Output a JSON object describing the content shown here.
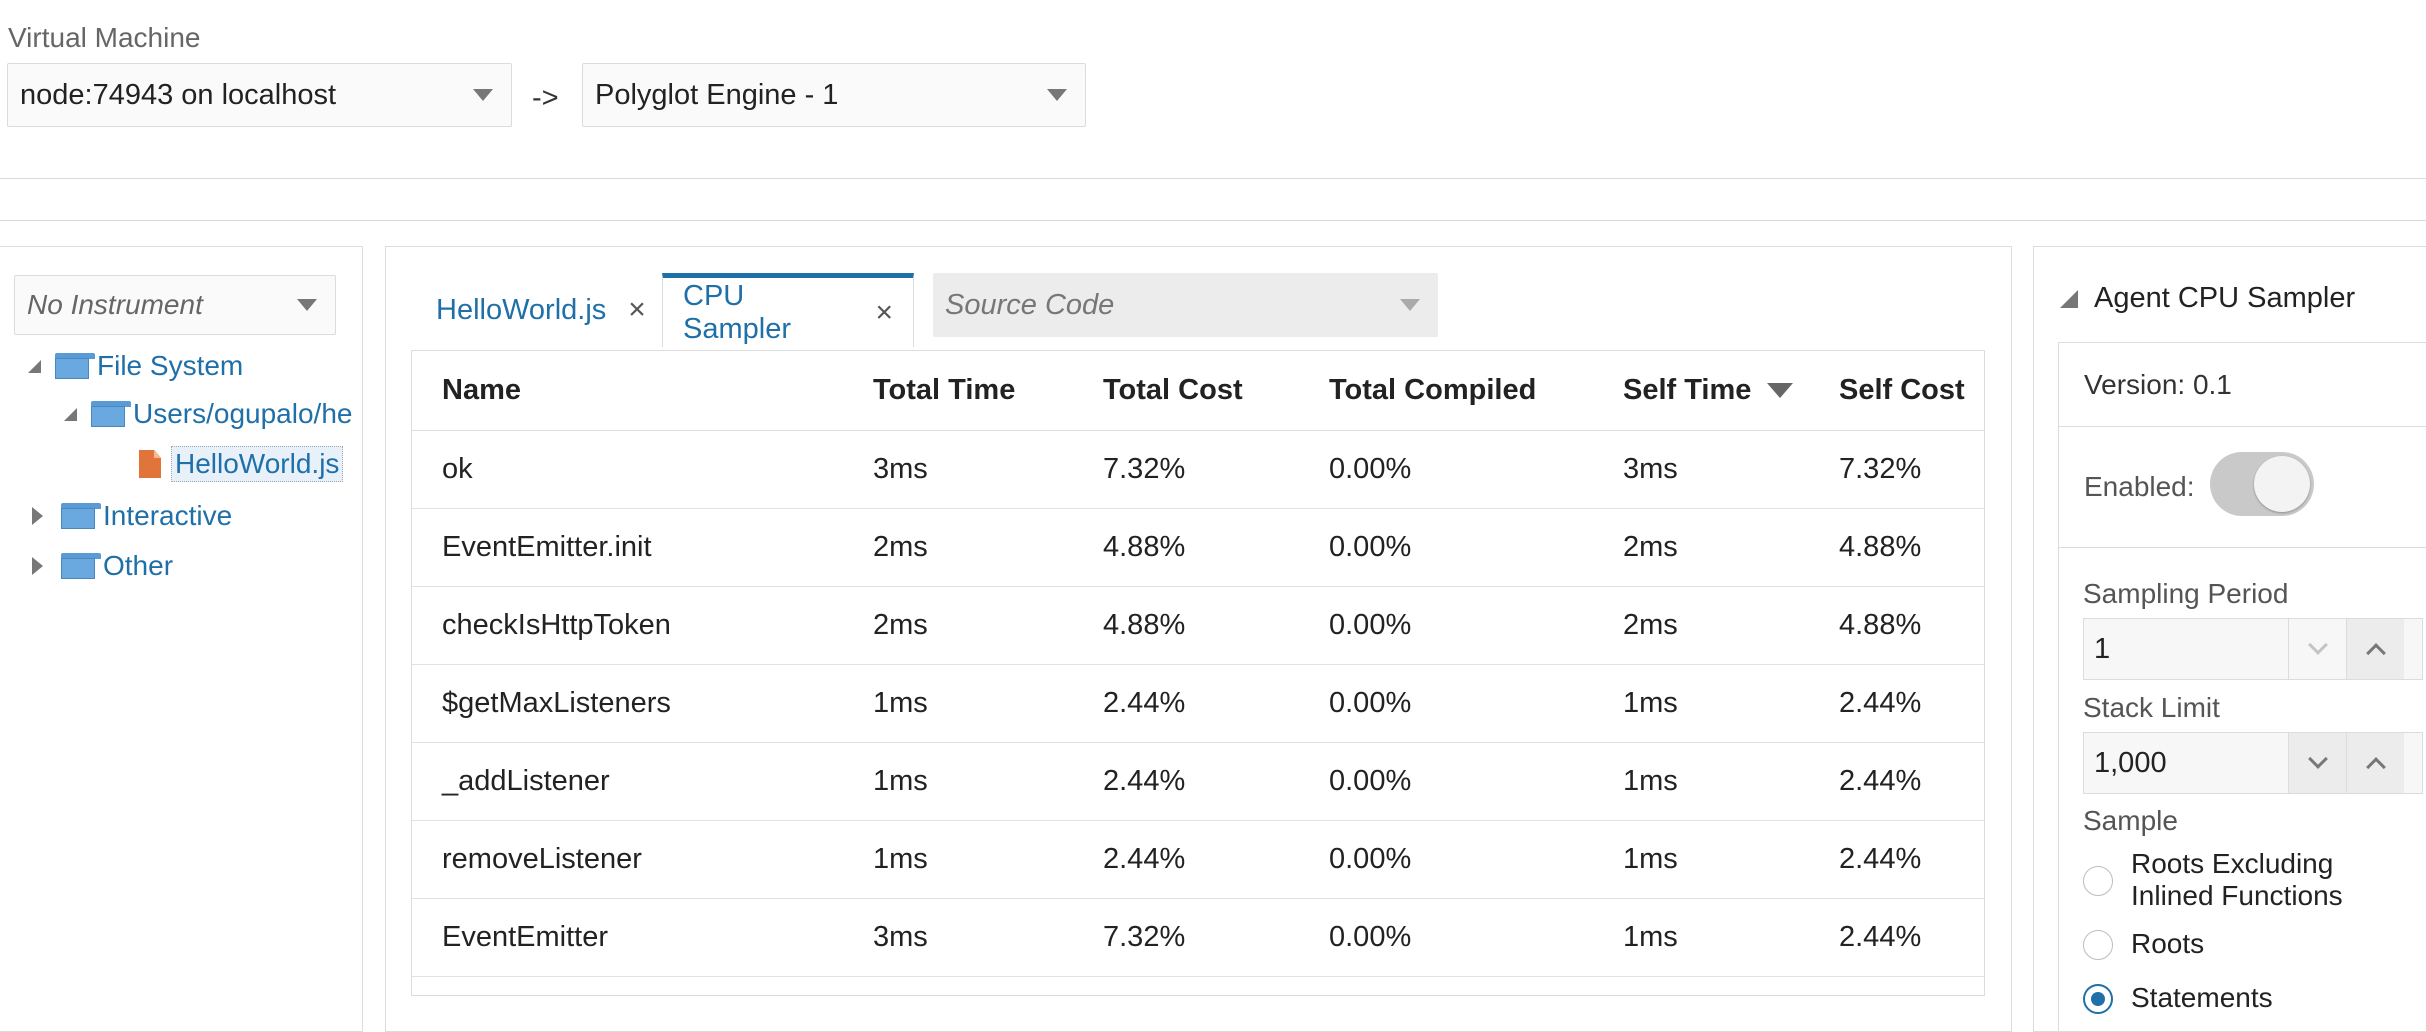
{
  "header": {
    "vm_label": "Virtual Machine",
    "vm_select": "node:74943 on localhost",
    "arrow": "->",
    "engine_select": "Polyglot Engine - 1"
  },
  "left": {
    "instrument_select": "No Instrument",
    "tree": [
      {
        "label": "File System",
        "expanded": true
      },
      {
        "label": "Users/ogupalo/he",
        "expanded": true
      },
      {
        "label": "HelloWorld.js",
        "selected": true
      },
      {
        "label": "Interactive",
        "expanded": false
      },
      {
        "label": "Other",
        "expanded": false
      }
    ]
  },
  "tabs": [
    {
      "label": "HelloWorld.js",
      "close": "×",
      "active": false
    },
    {
      "label": "CPU Sampler",
      "close": "×",
      "active": true
    }
  ],
  "source_select": "Source Code",
  "table": {
    "headers": [
      "Name",
      "Total Time",
      "Total Cost",
      "Total Compiled",
      "Self Time",
      "Self Cost"
    ],
    "sorted_column": "Self Time",
    "rows": [
      [
        "ok",
        "3ms",
        "7.32%",
        "0.00%",
        "3ms",
        "7.32%"
      ],
      [
        "EventEmitter.init",
        "2ms",
        "4.88%",
        "0.00%",
        "2ms",
        "4.88%"
      ],
      [
        "checkIsHttpToken",
        "2ms",
        "4.88%",
        "0.00%",
        "2ms",
        "4.88%"
      ],
      [
        "$getMaxListeners",
        "1ms",
        "2.44%",
        "0.00%",
        "1ms",
        "2.44%"
      ],
      [
        "_addListener",
        "1ms",
        "2.44%",
        "0.00%",
        "1ms",
        "2.44%"
      ],
      [
        "removeListener",
        "1ms",
        "2.44%",
        "0.00%",
        "1ms",
        "2.44%"
      ],
      [
        "EventEmitter",
        "3ms",
        "7.32%",
        "0.00%",
        "1ms",
        "2.44%"
      ]
    ]
  },
  "right": {
    "title": "Agent CPU Sampler",
    "version": "Version: 0.1",
    "enabled_label": "Enabled:",
    "enabled": false,
    "sampling_period_label": "Sampling Period",
    "sampling_period": "1",
    "stack_limit_label": "Stack Limit",
    "stack_limit": "1,000",
    "sample_label": "Sample",
    "sample_options": [
      {
        "label_line1": "Roots Excluding",
        "label_line2": "Inlined Functions",
        "checked": false
      },
      {
        "label_line1": "Roots",
        "label_line2": "",
        "checked": false
      },
      {
        "label_line1": "Statements",
        "label_line2": "",
        "checked": true
      }
    ]
  },
  "colors": {
    "accent": "#1f6fa8",
    "folder": "#6aa9e0",
    "file": "#e0743a"
  }
}
